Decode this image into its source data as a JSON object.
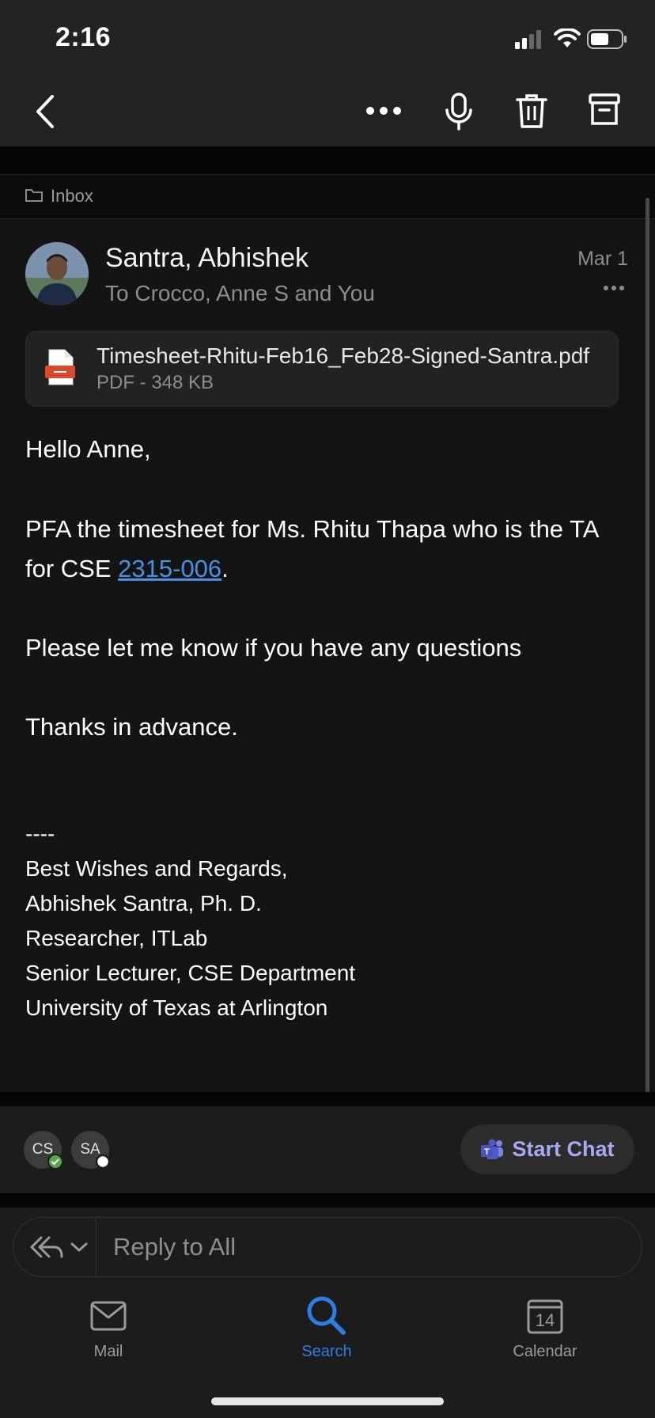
{
  "status": {
    "time": "2:16"
  },
  "folder": {
    "label": "Inbox"
  },
  "email": {
    "sender": "Santra, Abhishek",
    "recipients": "To Crocco, Anne S and You",
    "date": "Mar 1",
    "attachment": {
      "name": "Timesheet-Rhitu-Feb16_Feb28-Signed-Santra.pdf",
      "meta": "PDF - 348 KB"
    },
    "greeting": "Hello Anne,",
    "para1_line1": "PFA the timesheet for Ms. Rhitu Thapa who is the TA",
    "para1_line2_prefix": "for CSE ",
    "para1_link": "2315-006",
    "para1_suffix": ".",
    "para2": "Please let me know if you have any questions",
    "para3": "Thanks in advance.",
    "signature": {
      "dashes": "----",
      "line1": "Best Wishes and Regards,",
      "line2": "Abhishek Santra, Ph. D.",
      "line3": "Researcher, ITLab",
      "line4": "Senior Lecturer, CSE Department",
      "line5": "University of Texas at Arlington"
    }
  },
  "participants": [
    {
      "initials": "CS",
      "status": "available"
    },
    {
      "initials": "SA",
      "status": "offline"
    }
  ],
  "chat_button": {
    "label": "Start Chat"
  },
  "reply": {
    "placeholder": "Reply to All"
  },
  "nav": {
    "mail": "Mail",
    "search": "Search",
    "calendar": "Calendar",
    "calendar_day": "14"
  },
  "colors": {
    "accent": "#2f7de1",
    "link": "#4a90e2",
    "teams": "#a9a8f0"
  }
}
